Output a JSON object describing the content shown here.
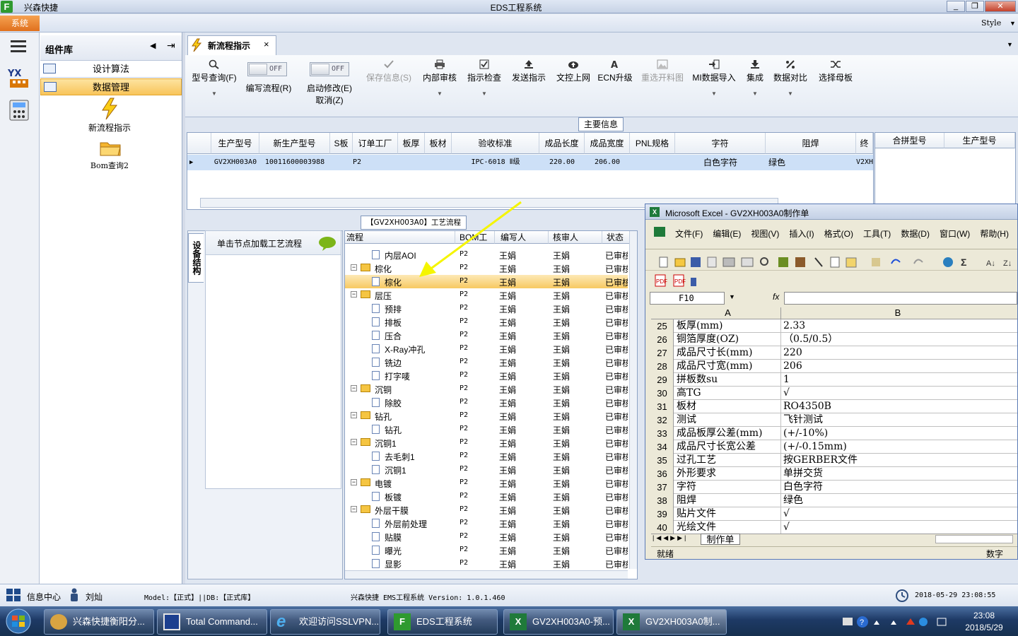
{
  "titlebar": {
    "app_short": "兴森快捷",
    "title": "EDS工程系统",
    "min": "_",
    "restore": "❐",
    "close": "✕"
  },
  "menubar": {
    "system": "系统",
    "style": "Style"
  },
  "component_panel": {
    "title": "组件库",
    "items": [
      "设计算法",
      "数据管理"
    ],
    "icons": [
      {
        "label": "新流程指示"
      },
      {
        "label": "Bom查询2"
      }
    ]
  },
  "tab": {
    "label": "新流程指示",
    "close": "×"
  },
  "toolbar": {
    "model_query": "型号查询(F)",
    "edit_flow": "编写流程(R)",
    "edit_flow_toggle": "OFF",
    "start_modify": "启动修改(E)",
    "start_modify_sub": "取消(Z)",
    "start_modify_toggle": "OFF",
    "save_info": "保存信息(S)",
    "internal_review": "内部审核",
    "instruction_check": "指示检查",
    "send_instruction": "发送指示",
    "text_upload": "文控上网",
    "ecn_upgrade": "ECN升级",
    "reselect_material": "重选开料图",
    "mi_import": "MI数据导入",
    "integrate": "集成",
    "data_compare": "数据对比",
    "select_mother": "选择母板"
  },
  "main_info": {
    "section_label": "主要信息",
    "columns": [
      "生产型号",
      "新生产型号",
      "S板",
      "订单工厂",
      "板厚",
      "板材",
      "验收标准",
      "成品长度",
      "成品宽度",
      "PNL规格",
      "字符",
      "阻焊",
      "终"
    ],
    "row": [
      "GV2XH003A0",
      "10011600003988",
      "",
      "P2",
      "",
      "",
      "IPC-6018 Ⅱ级",
      "220.00",
      "206.00",
      "",
      "白色字符",
      "绿色",
      "V2XH"
    ],
    "side_columns": [
      "合拼型号",
      "生产型号"
    ]
  },
  "process": {
    "section_label": "【GV2XH003A0】工艺流程",
    "vertical_tab": "设备结构",
    "node_hint": "单击节点加载工艺流程",
    "columns": [
      "流程",
      "BOM工厂",
      "编写人",
      "核审人",
      "状态"
    ],
    "rows": [
      {
        "name": "内层AOI",
        "level": 2,
        "factory": "P2",
        "writer": "王娟",
        "reviewer": "王娟",
        "status": "已审核"
      },
      {
        "name": "棕化",
        "level": 1,
        "factory": "P2",
        "writer": "王娟",
        "reviewer": "王娟",
        "status": "已审核"
      },
      {
        "name": "棕化",
        "level": 2,
        "factory": "P2",
        "writer": "王娟",
        "reviewer": "王娟",
        "status": "已审核",
        "selected": true
      },
      {
        "name": "层压",
        "level": 1,
        "factory": "P2",
        "writer": "王娟",
        "reviewer": "王娟",
        "status": "已审核"
      },
      {
        "name": "预排",
        "level": 2,
        "factory": "P2",
        "writer": "王娟",
        "reviewer": "王娟",
        "status": "已审核"
      },
      {
        "name": "排板",
        "level": 2,
        "factory": "P2",
        "writer": "王娟",
        "reviewer": "王娟",
        "status": "已审核"
      },
      {
        "name": "压合",
        "level": 2,
        "factory": "P2",
        "writer": "王娟",
        "reviewer": "王娟",
        "status": "已审核"
      },
      {
        "name": "X-Ray冲孔",
        "level": 2,
        "factory": "P2",
        "writer": "王娟",
        "reviewer": "王娟",
        "status": "已审核"
      },
      {
        "name": "铣边",
        "level": 2,
        "factory": "P2",
        "writer": "王娟",
        "reviewer": "王娟",
        "status": "已审核"
      },
      {
        "name": "打字唛",
        "level": 2,
        "factory": "P2",
        "writer": "王娟",
        "reviewer": "王娟",
        "status": "已审核"
      },
      {
        "name": "沉铜",
        "level": 1,
        "factory": "P2",
        "writer": "王娟",
        "reviewer": "王娟",
        "status": "已审核"
      },
      {
        "name": "除胶",
        "level": 2,
        "factory": "P2",
        "writer": "王娟",
        "reviewer": "王娟",
        "status": "已审核"
      },
      {
        "name": "钻孔",
        "level": 1,
        "factory": "P2",
        "writer": "王娟",
        "reviewer": "王娟",
        "status": "已审核"
      },
      {
        "name": "钻孔",
        "level": 2,
        "factory": "P2",
        "writer": "王娟",
        "reviewer": "王娟",
        "status": "已审核"
      },
      {
        "name": "沉铜1",
        "level": 1,
        "factory": "P2",
        "writer": "王娟",
        "reviewer": "王娟",
        "status": "已审核"
      },
      {
        "name": "去毛刺1",
        "level": 2,
        "factory": "P2",
        "writer": "王娟",
        "reviewer": "王娟",
        "status": "已审核"
      },
      {
        "name": "沉铜1",
        "level": 2,
        "factory": "P2",
        "writer": "王娟",
        "reviewer": "王娟",
        "status": "已审核"
      },
      {
        "name": "电镀",
        "level": 1,
        "factory": "P2",
        "writer": "王娟",
        "reviewer": "王娟",
        "status": "已审核"
      },
      {
        "name": "板镀",
        "level": 2,
        "factory": "P2",
        "writer": "王娟",
        "reviewer": "王娟",
        "status": "已审核"
      },
      {
        "name": "外层干膜",
        "level": 1,
        "factory": "P2",
        "writer": "王娟",
        "reviewer": "王娟",
        "status": "已审核"
      },
      {
        "name": "外层前处理",
        "level": 2,
        "factory": "P2",
        "writer": "王娟",
        "reviewer": "王娟",
        "status": "已审核"
      },
      {
        "name": "贴膜",
        "level": 2,
        "factory": "P2",
        "writer": "王娟",
        "reviewer": "王娟",
        "status": "已审核"
      },
      {
        "name": "曝光",
        "level": 2,
        "factory": "P2",
        "writer": "王娟",
        "reviewer": "王娟",
        "status": "已审核"
      },
      {
        "name": "显影",
        "level": 2,
        "factory": "P2",
        "writer": "王娟",
        "reviewer": "王娟",
        "status": "已审核"
      }
    ]
  },
  "excel": {
    "title": "Microsoft Excel - GV2XH003A0制作单",
    "menu": [
      "文件(F)",
      "编辑(E)",
      "视图(V)",
      "插入(I)",
      "格式(O)",
      "工具(T)",
      "数据(D)",
      "窗口(W)",
      "帮助(H)"
    ],
    "name_box": "F10",
    "fx": "fx",
    "col_a": "A",
    "col_b": "B",
    "rows": [
      {
        "n": "25",
        "a": "板厚(mm)",
        "b": "2.33"
      },
      {
        "n": "26",
        "a": "铜箔厚度(OZ)",
        "b": "（0.5/0.5）"
      },
      {
        "n": "27",
        "a": "成品尺寸长(mm)",
        "b": "220"
      },
      {
        "n": "28",
        "a": "成品尺寸宽(mm)",
        "b": "206"
      },
      {
        "n": "29",
        "a": "拼板数su",
        "b": "1"
      },
      {
        "n": "30",
        "a": "高TG",
        "b": "√"
      },
      {
        "n": "31",
        "a": "板材",
        "b": "RO4350B"
      },
      {
        "n": "32",
        "a": "测试",
        "b": "飞针测试"
      },
      {
        "n": "33",
        "a": "成品板厚公差(mm)",
        "b": "(+/-10%)"
      },
      {
        "n": "34",
        "a": "成品尺寸长宽公差",
        "b": "(+/-0.15mm)"
      },
      {
        "n": "35",
        "a": "过孔工艺",
        "b": "按GERBER文件"
      },
      {
        "n": "36",
        "a": "外形要求",
        "b": "单拼交货"
      },
      {
        "n": "37",
        "a": "字符",
        "b": "白色字符"
      },
      {
        "n": "38",
        "a": "阻焊",
        "b": "绿色"
      },
      {
        "n": "39",
        "a": "贴片文件",
        "b": "√"
      },
      {
        "n": "40",
        "a": "光绘文件",
        "b": "√"
      }
    ],
    "sheet_tab": "制作单",
    "status": "就绪",
    "num": "数字"
  },
  "statusbar": {
    "info_center": "信息中心",
    "user": "刘灿",
    "model_db": "Model:【正式】||DB:【正式库】",
    "version": "兴森快捷 EMS工程系统 Version: 1.0.1.460",
    "datetime": "2018-05-29 23:08:55"
  },
  "taskbar": {
    "items": [
      "兴森快捷衡阳分...",
      "Total Command...",
      "欢迎访问SSLVPN...",
      "EDS工程系统",
      "GV2XH003A0-预...",
      "GV2XH003A0制..."
    ],
    "time": "23:08",
    "date": "2018/5/29"
  }
}
